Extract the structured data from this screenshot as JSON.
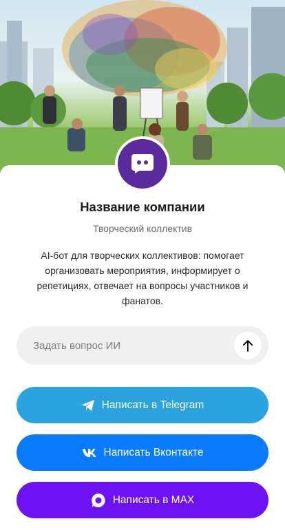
{
  "company": {
    "name": "Название компании",
    "subtitle": "Творческий коллектив",
    "description": "AI-бот для творческих коллективов: помогает организовать мероприятия, информирует о репетициях, отвечает на вопросы участников и фанатов."
  },
  "ask": {
    "placeholder": "Задать вопрос ИИ"
  },
  "buttons": {
    "telegram": "Написать в Telegram",
    "vk": "Написать Вконтакте",
    "max": "Написать в MAX"
  },
  "colors": {
    "avatar": "#5b2a9c",
    "telegram": "#2aa3df",
    "vk": "#0a7aff",
    "max": "#6d12f2"
  },
  "icons": {
    "avatar": "chat-bot-icon",
    "send": "arrow-up-icon",
    "telegram": "telegram-icon",
    "vk": "vk-icon",
    "max": "max-icon"
  }
}
